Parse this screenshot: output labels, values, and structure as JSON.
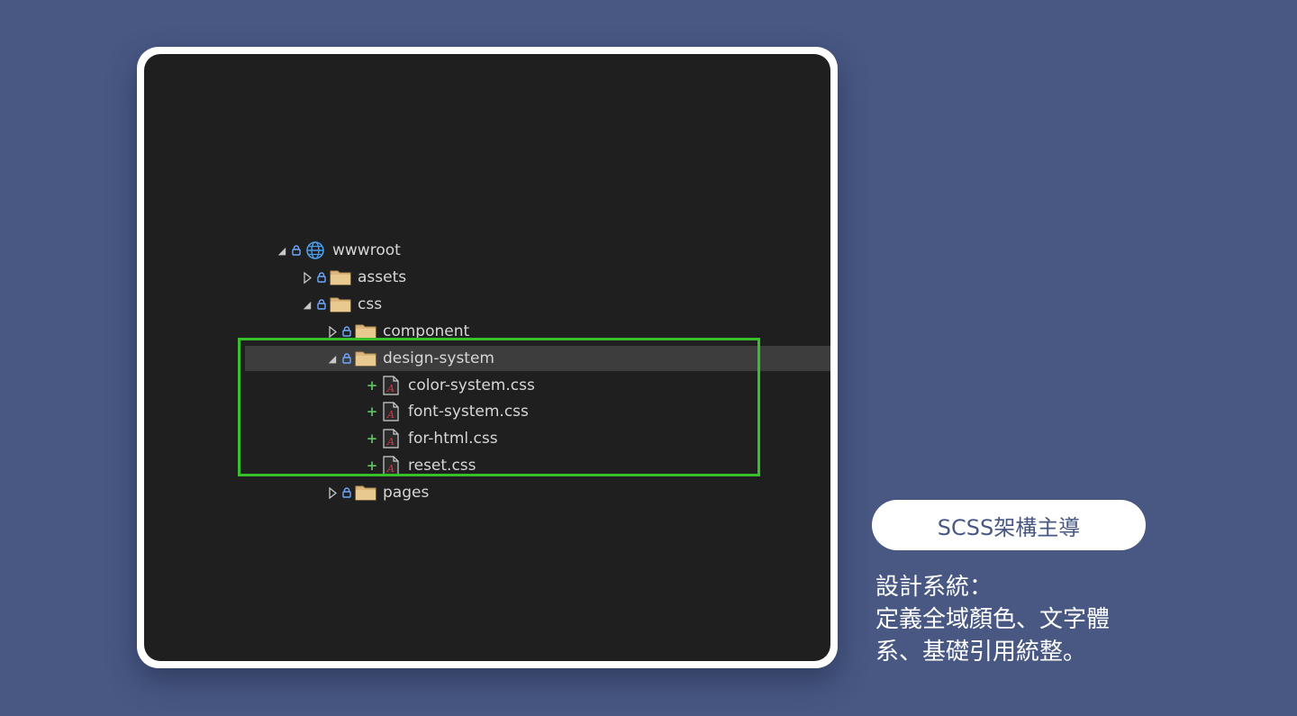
{
  "tree": {
    "items": [
      {
        "label": "wwwroot",
        "icon": "globe-icon",
        "state": "expanded"
      },
      {
        "label": "assets",
        "icon": "folder-icon",
        "state": "collapsed"
      },
      {
        "label": "css",
        "icon": "folder-icon",
        "state": "expanded"
      },
      {
        "label": "component",
        "icon": "folder-icon",
        "state": "collapsed"
      },
      {
        "label": "design-system",
        "icon": "folder-icon",
        "state": "expanded",
        "selected": true
      },
      {
        "label": "color-system.css",
        "icon": "css-file-icon",
        "status": "+"
      },
      {
        "label": "font-system.css",
        "icon": "css-file-icon",
        "status": "+"
      },
      {
        "label": "for-html.css",
        "icon": "css-file-icon",
        "status": "+"
      },
      {
        "label": "reset.css",
        "icon": "css-file-icon",
        "status": "+"
      },
      {
        "label": "pages",
        "icon": "folder-icon",
        "state": "collapsed"
      }
    ]
  },
  "callout": {
    "pill_label": "SCSS架構主導",
    "description_lines": [
      "設計系統：",
      "定義全域顏色、文字體",
      "系、基礎引用統整。"
    ]
  },
  "colors": {
    "background": "#485883",
    "editor": "#1f1f1f",
    "highlight_border": "#37c02c",
    "folder": "#dcb67a",
    "lock": "#6fa8ff",
    "added": "#5fbf5f"
  }
}
